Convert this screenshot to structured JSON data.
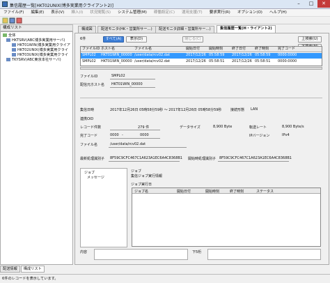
{
  "window": {
    "title": "集信履歴一覧[HKT02UNIX(博多実業用クライアント2)]"
  },
  "menu": [
    "ファイル(F)",
    "編集(E)",
    "表示(V)",
    "挿入(I)",
    "状況閲覧(S)",
    "システム管理(M)",
    "稼働設定(C)",
    "運用支援(T)",
    "要求実行(R)",
    "オプション(O)",
    "ヘルプ(H)"
  ],
  "left_panel": {
    "title": "構成リスト",
    "nodes": [
      "全体",
      "HKTSRV(ABC博多実業用サーバ)",
      "HKT01WIN(博多実業用クライア",
      "HKT02UNIX(博多実業用クライ",
      "HKT03UNIX(博多実業用クライ",
      "TKYSRV(ABC東京本社サーバ)"
    ],
    "tabs": [
      "配送情報",
      "構成リスト"
    ]
  },
  "tabs": [
    "構成図",
    "配送モニタ(HK・営業所サー…)",
    "配送モニタ詳細・営業所サー…)",
    "集信履歴一覧(H・ライアント2)"
  ],
  "buttons": {
    "all": "すべて(A)",
    "display": "表示(D)",
    "close": "閉じる(C)",
    "up": "上検索(U)",
    "down": "下検索(M)",
    "count": "6件"
  },
  "grid": {
    "columns": [
      "ファイルID",
      "ホスト名",
      "ファイル名",
      "開始日付",
      "開始時刻",
      "終了日付",
      "終了時刻",
      "完了コード"
    ],
    "rows": [
      [
        "SMPL02",
        "HKT01WIN_00000",
        "/user/data/rcv02.dat",
        "2017/12/26",
        "05:58:59",
        "2017/12/26",
        "05:58:59",
        "0000:0000"
      ],
      [
        "SMPL02",
        "HKT01WIN_00000",
        "/user/data/rcv02.dat",
        "2017/12/26",
        "05:58:51",
        "2017/12/26",
        "05:58:51",
        "0000:0000"
      ]
    ]
  },
  "detail": {
    "file_id_label": "ファイルID",
    "file_id": "SMPL02",
    "host_label": "配信元ホスト名",
    "host": "HKT01WIN_00000",
    "time_label": "集信日時",
    "time": "2017年12月26日 05時58分59秒 ～ 2017年12月26日 05時58分59秒",
    "line_label": "接続形態",
    "line": "LAN",
    "oid_label": "連携OID",
    "records_label": "レコード件数",
    "records": "279 件",
    "datasize_label": "データサイズ",
    "datasize": "8,900 Byte",
    "rate_label": "転送レート",
    "rate": "8,900 Byte/s",
    "code_label": "完了コード",
    "code1": "0000",
    "code2": "0000",
    "ipver_label": "IPバージョン",
    "ipver": "IPv4",
    "filename_label": "ファイル名",
    "filename": "/user/data/rcv02.dat",
    "newid_label": "最新処理識別子",
    "newid": "8F59C9CFC467C1A623A1EC6A4C8368B1",
    "prid_label": "開始時処理識別子",
    "prid": "8F59C9CFC467C1A623A1EC6A4C8368B1",
    "tree_items": [
      "ジョブ",
      "メッセージ"
    ],
    "job_label": "ジョブ",
    "job_info_label": "集信ジョブ実行情報",
    "job_exec_label": "ジョブ実行日",
    "job_columns": [
      "ジョブ名",
      "開始日付",
      "開始時刻",
      "終了時刻",
      "ステータス"
    ],
    "content_label": "内容",
    "notes_label": "下5桁"
  },
  "status": "6件のレコードを表示しています。"
}
